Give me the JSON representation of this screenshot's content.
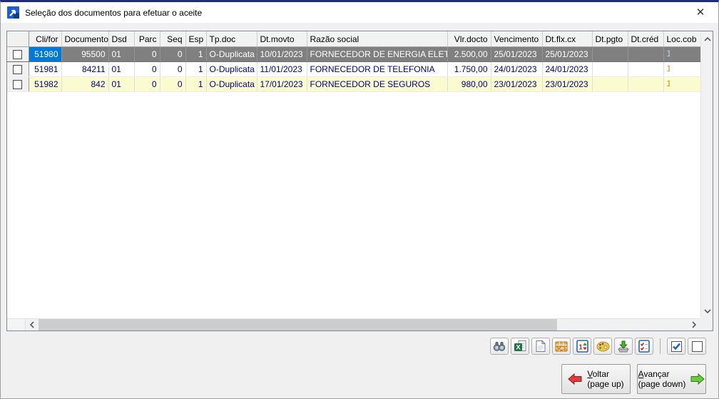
{
  "window": {
    "title": "Seleção dos documentos para efetuar o aceite",
    "close_glyph": "✕"
  },
  "colors": {
    "titlebar_border": "#1f2d7e",
    "selected_row_bg": "#808080",
    "selected_cell_bg": "#0078d7",
    "alt_row_bg": "#fbfbd0",
    "grid_text": "#000080",
    "voltar_arrow": "#e23b3b",
    "avancar_arrow": "#6cc93e"
  },
  "table": {
    "columns": [
      {
        "label": ""
      },
      {
        "label": "Cli/for"
      },
      {
        "label": "Documento"
      },
      {
        "label": "Dsd"
      },
      {
        "label": "Parc"
      },
      {
        "label": "Seq"
      },
      {
        "label": "Esp"
      },
      {
        "label": "Tp.doc"
      },
      {
        "label": "Dt.movto"
      },
      {
        "label": "Razão social"
      },
      {
        "label": "Vlr.docto"
      },
      {
        "label": "Vencimento"
      },
      {
        "label": "Dt.flx.cx"
      },
      {
        "label": "Dt.pgto"
      },
      {
        "label": "Dt.créd"
      },
      {
        "label": "Loc.cob"
      }
    ],
    "rows": [
      {
        "checked": false,
        "cli_for": "51980",
        "documento": "95500",
        "dsd": "01",
        "parc": "0",
        "seq": "0",
        "esp": "1",
        "tp_doc": "O-Duplicata",
        "dt_movto": "10/01/2023",
        "razao_social": "FORNECEDOR DE ENERGIA ELETRICA",
        "vlr_docto": "2.500,00",
        "vencimento": "25/01/2023",
        "dt_flx_cx": "25/01/2023",
        "dt_pgto": "",
        "dt_cred": "",
        "loc_cob": "1"
      },
      {
        "checked": false,
        "cli_for": "51981",
        "documento": "84211",
        "dsd": "01",
        "parc": "0",
        "seq": "0",
        "esp": "1",
        "tp_doc": "O-Duplicata",
        "dt_movto": "11/01/2023",
        "razao_social": "FORNECEDOR DE TELEFONIA",
        "vlr_docto": "1.750,00",
        "vencimento": "24/01/2023",
        "dt_flx_cx": "24/01/2023",
        "dt_pgto": "",
        "dt_cred": "",
        "loc_cob": "1"
      },
      {
        "checked": false,
        "cli_for": "51982",
        "documento": "842",
        "dsd": "01",
        "parc": "0",
        "seq": "0",
        "esp": "1",
        "tp_doc": "O-Duplicata",
        "dt_movto": "17/01/2023",
        "razao_social": "FORNECEDOR DE SEGUROS",
        "vlr_docto": "980,00",
        "vencimento": "23/01/2023",
        "dt_flx_cx": "23/01/2023",
        "dt_pgto": "",
        "dt_cred": "",
        "loc_cob": "1"
      }
    ]
  },
  "toolbar": {
    "icons": [
      "binoculars-search",
      "excel-export",
      "document-report",
      "cell-select-hand",
      "sort-order",
      "color-palette",
      "file-export",
      "conference-checklist",
      "check-all",
      "uncheck-all"
    ]
  },
  "scroll_icons": [
    "up-chevron",
    "down-chevron",
    "left-chevron",
    "right-chevron"
  ],
  "nav": {
    "voltar": {
      "initial": "V",
      "rest": "oltar",
      "line2": "(page up)"
    },
    "avancar": {
      "initial": "A",
      "rest": "vançar",
      "line2": "(page down)"
    }
  }
}
